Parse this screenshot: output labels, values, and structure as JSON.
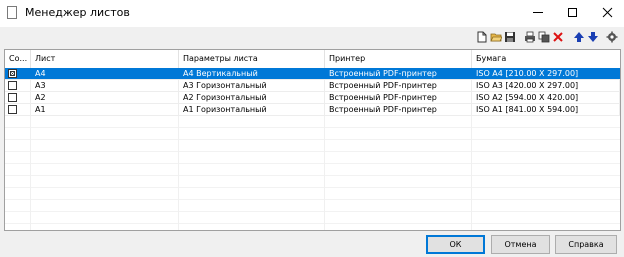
{
  "window": {
    "title": "Менеджер листов"
  },
  "colors": {
    "selection": "#0078d7",
    "header_bg": "#ffffff",
    "window_bg": "#f0f0f0"
  },
  "toolbar": {
    "icons": [
      "new-document-icon",
      "open-folder-icon",
      "save-icon",
      "print-settings-icon",
      "copy-icon",
      "delete-icon",
      "move-up-icon",
      "move-down-icon",
      "settings-icon"
    ]
  },
  "grid": {
    "headers": [
      "Со...",
      "Лист",
      "Параметры листа",
      "Принтер",
      "Бумага"
    ],
    "rows": [
      {
        "checked": true,
        "sheet": "А4",
        "params": "А4 Вертикальный",
        "printer": "Встроенный PDF-принтер",
        "paper": "ISO A4 [210.00 X 297.00]",
        "selected": true
      },
      {
        "checked": false,
        "sheet": "А3",
        "params": "А3 Горизонтальный",
        "printer": "Встроенный PDF-принтер",
        "paper": "ISO A3 [420.00 X 297.00]",
        "selected": false
      },
      {
        "checked": false,
        "sheet": "А2",
        "params": "А2 Горизонтальный",
        "printer": "Встроенный PDF-принтер",
        "paper": "ISO A2 [594.00 X 420.00]",
        "selected": false
      },
      {
        "checked": false,
        "sheet": "А1",
        "params": "А1 Горизонтальный",
        "printer": "Встроенный PDF-принтер",
        "paper": "ISO A1 [841.00 X 594.00]",
        "selected": false
      }
    ]
  },
  "buttons": {
    "ok": "ОК",
    "cancel": "Отмена",
    "help": "Справка"
  }
}
